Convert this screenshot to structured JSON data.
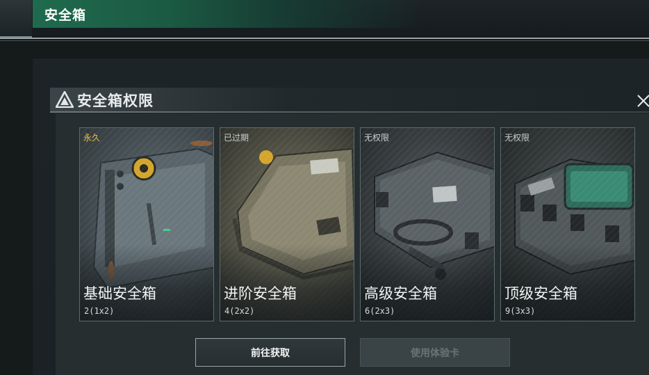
{
  "header": {
    "title": "安全箱"
  },
  "dialog": {
    "title": "安全箱权限",
    "icons": {
      "title_icon": "warning-triangle-icon",
      "close_icon": "close-icon"
    }
  },
  "cards": [
    {
      "status": "永久",
      "name": "基础安全箱",
      "size": "2(1x2)",
      "status_color": "#e9c04a",
      "theme": "#4a5458"
    },
    {
      "status": "已过期",
      "name": "进阶安全箱",
      "size": "4(2x2)",
      "status_color": "#c9d0d1",
      "theme": "#5b5a4c"
    },
    {
      "status": "无权限",
      "name": "高级安全箱",
      "size": "6(2x3)",
      "status_color": "#c9d0d1",
      "theme": "#3a3f41"
    },
    {
      "status": "无权限",
      "name": "顶级安全箱",
      "size": "9(3x3)",
      "status_color": "#c9d0d1",
      "theme": "#34393a"
    }
  ],
  "buttons": {
    "acquire": "前往获取",
    "trial_card": "使用体验卡"
  }
}
